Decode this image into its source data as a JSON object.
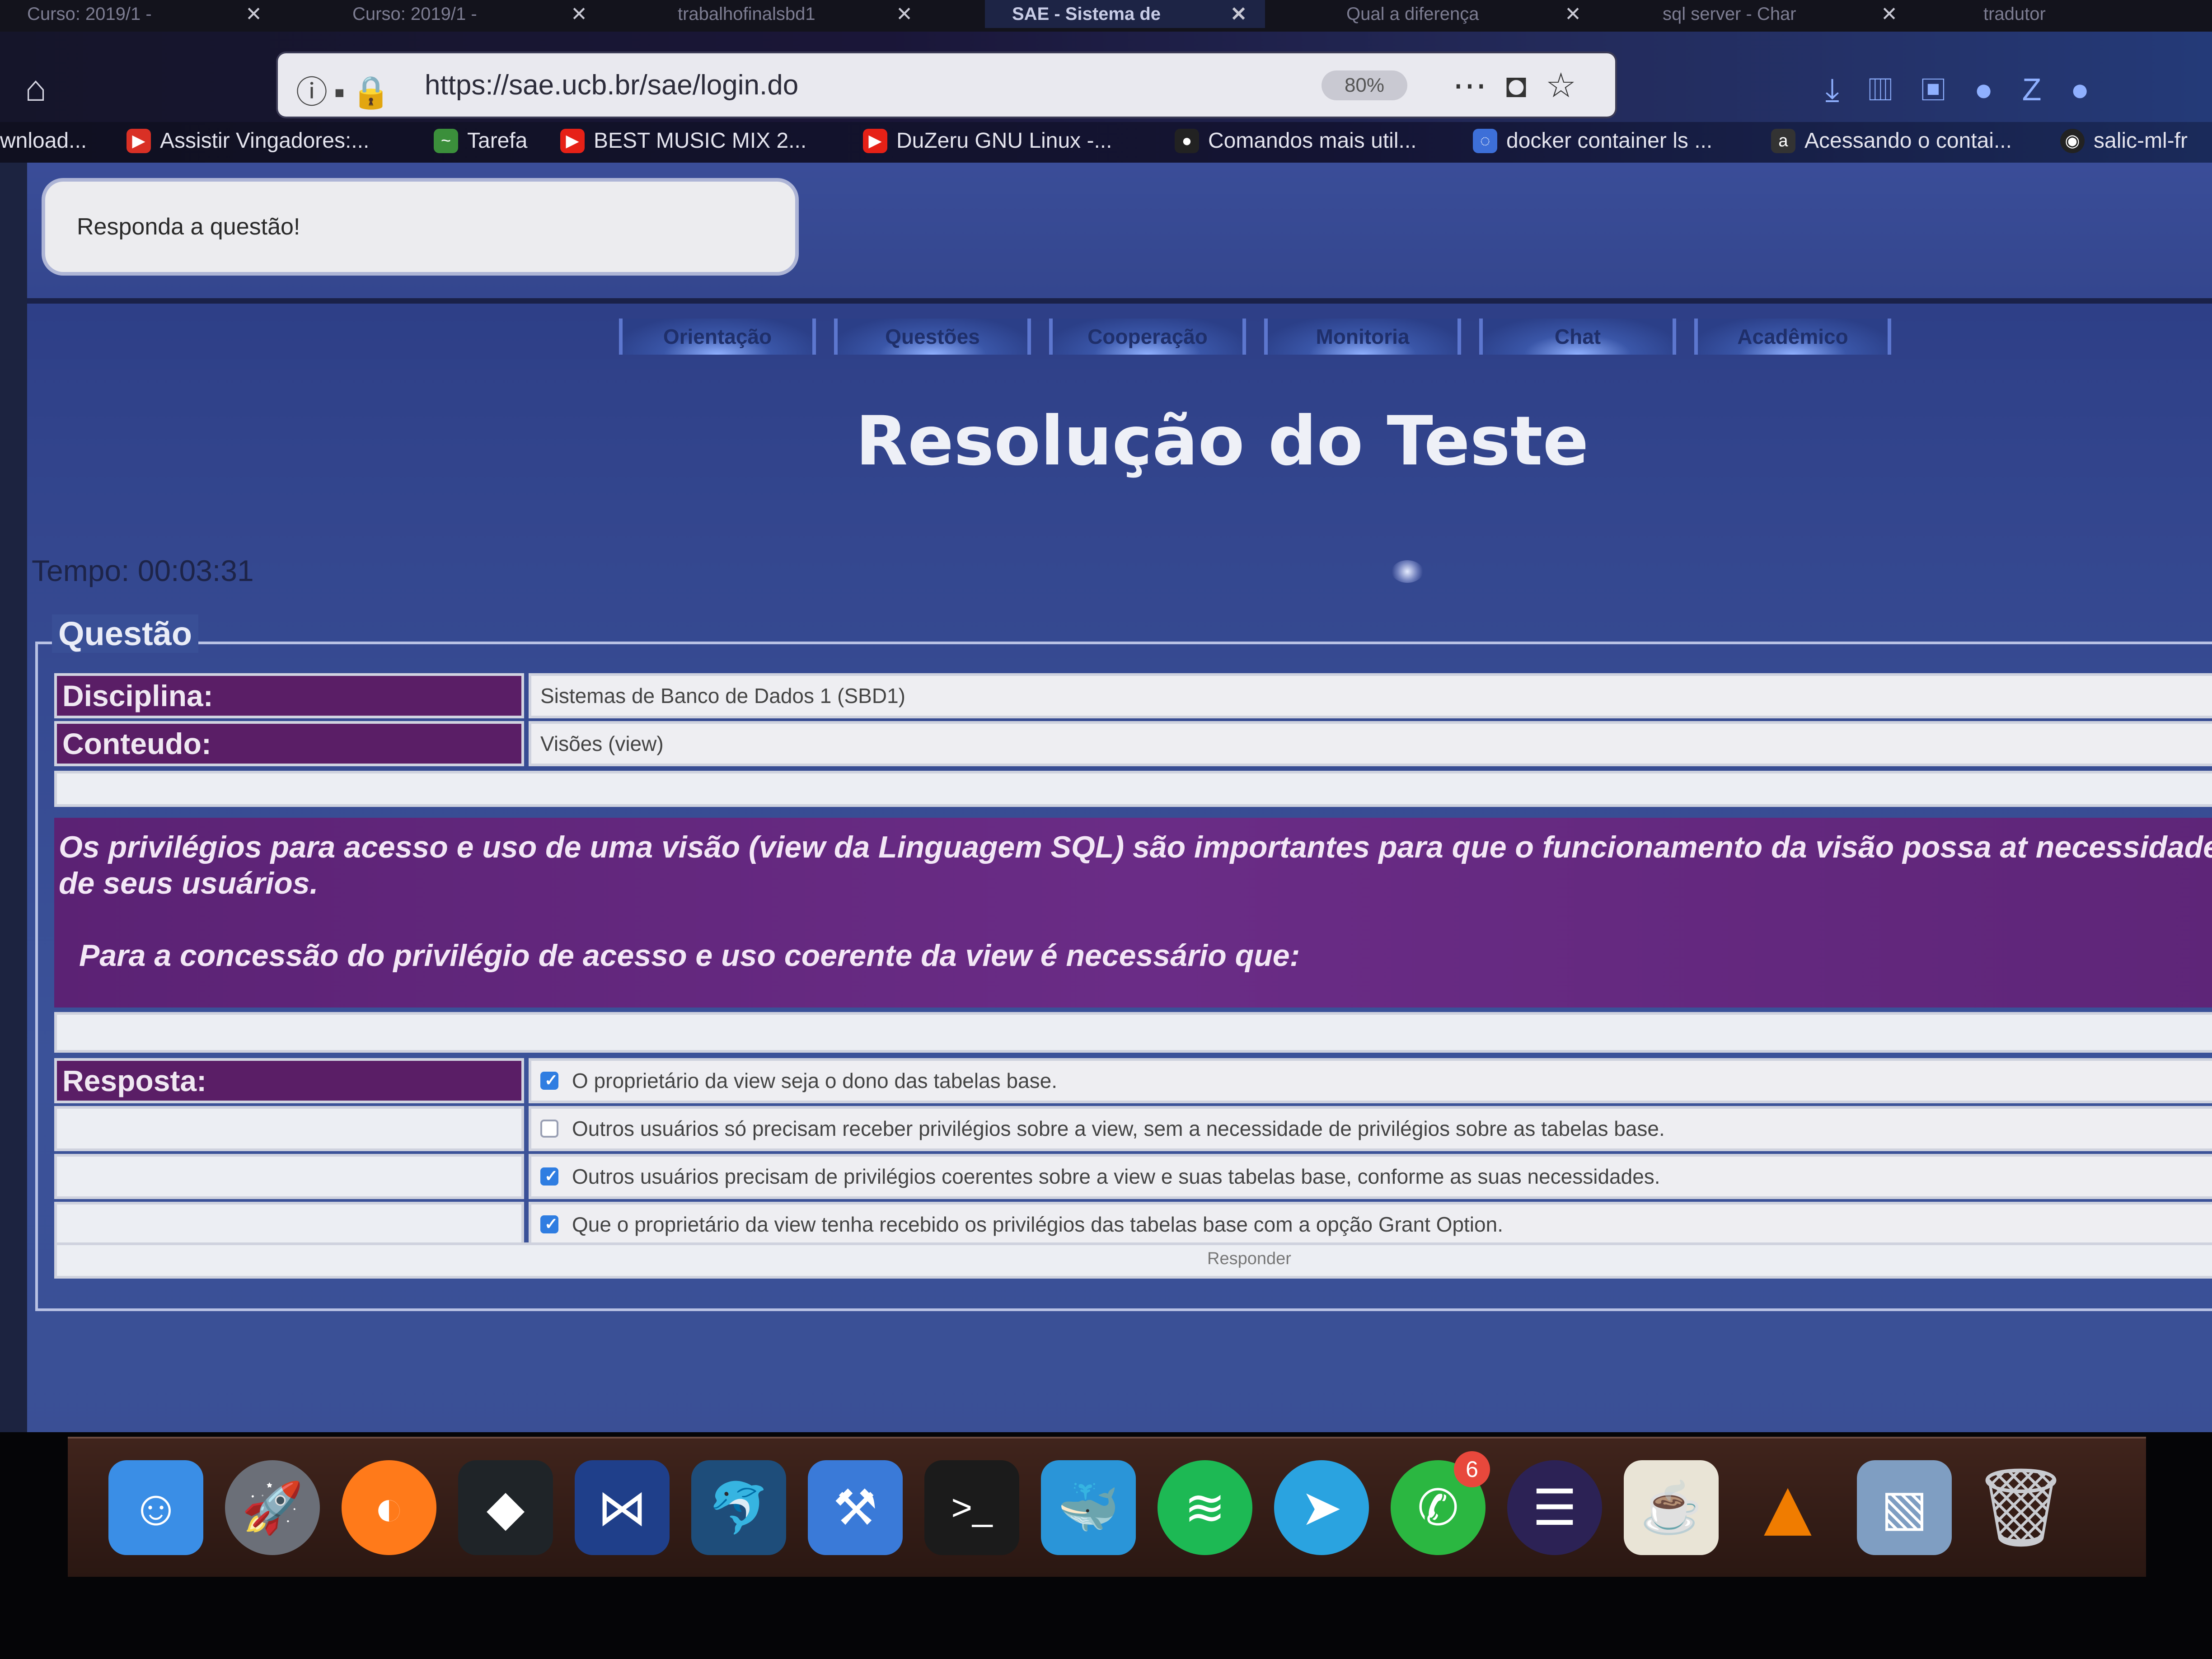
{
  "browser": {
    "tabs": [
      {
        "label": "Curso: 2019/1 -",
        "active": false
      },
      {
        "label": "Curso: 2019/1 -",
        "active": false
      },
      {
        "label": "trabalhofinalsbd1",
        "active": false
      },
      {
        "label": "SAE - Sistema de",
        "active": true
      },
      {
        "label": "Qual a diferença",
        "active": false
      },
      {
        "label": "sql server - Char",
        "active": false
      },
      {
        "label": "tradutor",
        "active": false
      }
    ],
    "url": "https://sae.ucb.br/sae/login.do",
    "zoom": "80%",
    "bookmarks": [
      {
        "label": "wnload...",
        "icon_color": "#555555"
      },
      {
        "label": "Assistir Vingadores:...",
        "icon_color": "#d93025"
      },
      {
        "label": "Tarefa",
        "icon_color": "#3b8f3b"
      },
      {
        "label": "BEST MUSIC MIX 2...",
        "icon_color": "#e62117"
      },
      {
        "label": "DuZeru GNU Linux -...",
        "icon_color": "#e62117"
      },
      {
        "label": "Comandos mais util...",
        "icon_color": "#222222"
      },
      {
        "label": "docker container ls ...",
        "icon_color": "#3d6fd8"
      },
      {
        "label": "Acessando o contai...",
        "icon_color": "#333333"
      },
      {
        "label": "salic-ml-fr",
        "icon_color": "#222222"
      }
    ]
  },
  "page": {
    "message": "Responda a questão!",
    "nav": [
      "Orientação",
      "Questões",
      "Cooperação",
      "Monitoria",
      "Chat",
      "Acadêmico"
    ],
    "title": "Resolução do Teste",
    "timer": "Tempo: 00:03:31",
    "section_legend": "Questão",
    "discipline_label": "Disciplina:",
    "discipline_value": "Sistemas de Banco de Dados 1 (SBD1)",
    "content_label": "Conteudo:",
    "content_value": "Visões (view)",
    "question_line1": "Os privilégios para acesso e uso de uma visão (view da Linguagem SQL) são importantes para que o funcionamento da visão possa at necessidades de seus usuários.",
    "question_line2": "Para a concessão do privilégio de acesso e uso coerente da view é necessário que:",
    "answer_label": "Resposta:",
    "options": [
      {
        "text": "O proprietário da view seja o dono das tabelas base.",
        "checked": true
      },
      {
        "text": "Outros usuários só precisam receber privilégios sobre a view, sem a necessidade de privilégios sobre as tabelas base.",
        "checked": false
      },
      {
        "text": "Outros usuários precisam de privilégios coerentes sobre a view e suas tabelas base, conforme as suas necessidades.",
        "checked": true
      },
      {
        "text": "Que o proprietário da view tenha recebido os privilégios das tabelas base com a opção Grant Option.",
        "checked": true
      }
    ],
    "submit_label": "Responder"
  },
  "dock": {
    "apps": [
      {
        "icon": "finder-icon",
        "color": "#3a8ee6"
      },
      {
        "icon": "launchpad-icon",
        "color": "#6b6f78"
      },
      {
        "icon": "firefox-icon",
        "color": "#ff7a1a"
      },
      {
        "icon": "filmora-icon",
        "color": "#1f2428"
      },
      {
        "icon": "vscode-icon",
        "color": "#1f3f8a"
      },
      {
        "icon": "mysql-workbench-icon",
        "color": "#1e4d7a"
      },
      {
        "icon": "xcode-icon",
        "color": "#3a7ad8"
      },
      {
        "icon": "terminal-icon",
        "color": "#1b1b1b"
      },
      {
        "icon": "docker-icon",
        "color": "#2a95d8"
      },
      {
        "icon": "spotify-icon",
        "color": "#1db954"
      },
      {
        "icon": "telegram-icon",
        "color": "#2aa3e0"
      },
      {
        "icon": "whatsapp-icon",
        "color": "#2bb741",
        "badge": "6"
      },
      {
        "icon": "eclipse-icon",
        "color": "#2c2255"
      },
      {
        "icon": "java-icon",
        "color": "#e9e4d6"
      },
      {
        "icon": "vlc-icon",
        "color": "#f07c00"
      },
      {
        "icon": "preview-icon",
        "color": "#7f9ec2"
      },
      {
        "icon": "trash-icon",
        "color": "#a9abb0"
      }
    ]
  }
}
